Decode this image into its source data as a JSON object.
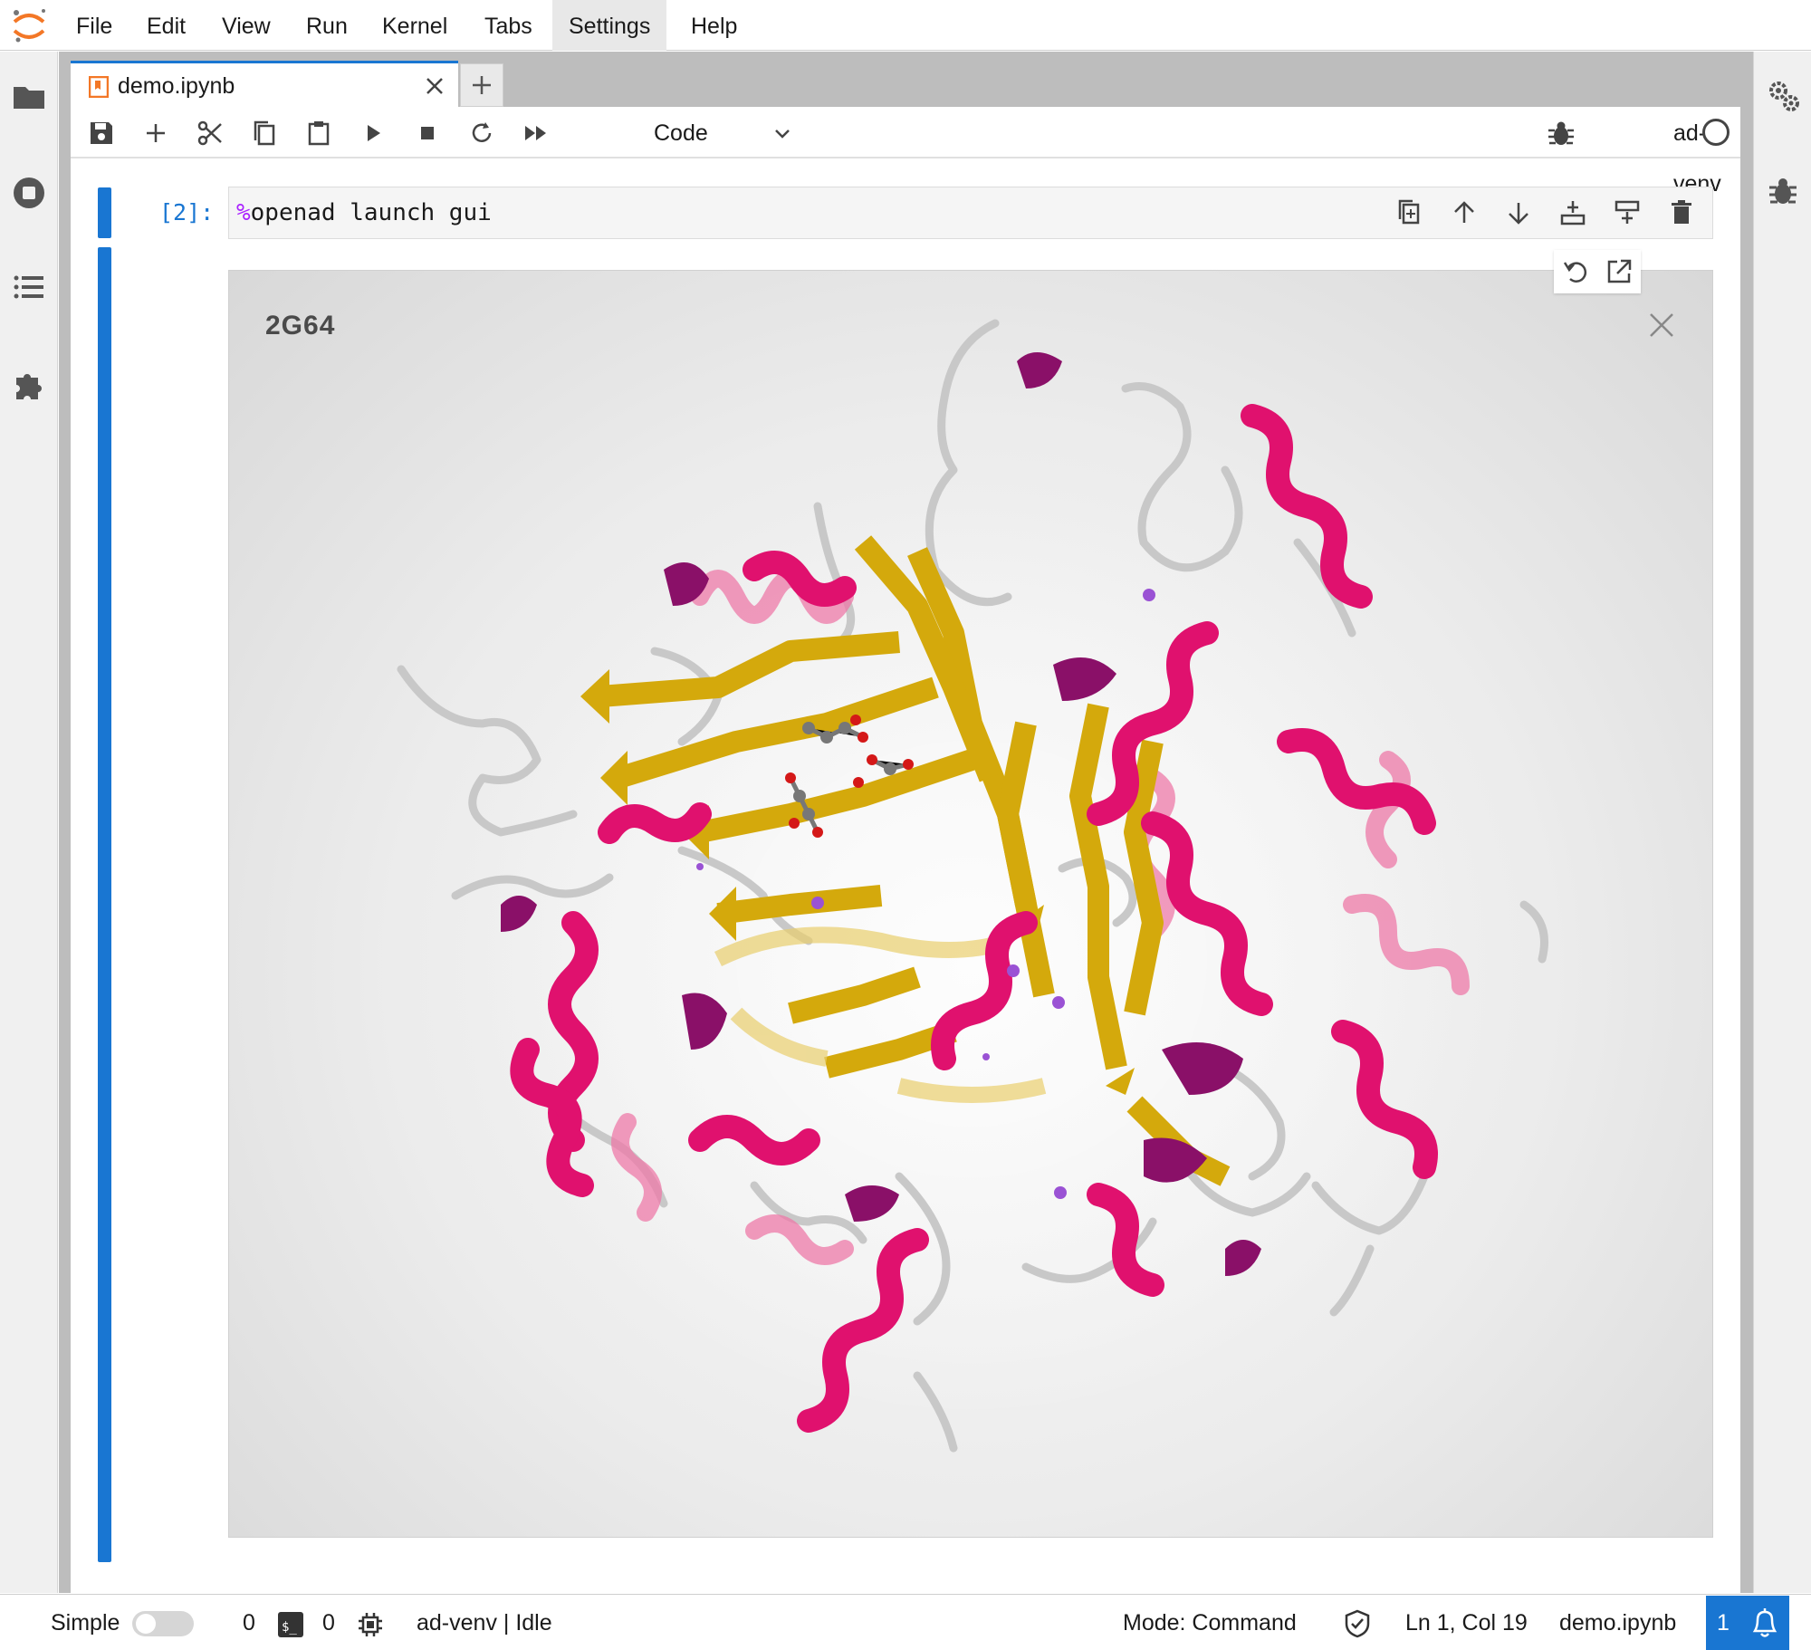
{
  "menu": {
    "items": [
      "File",
      "Edit",
      "View",
      "Run",
      "Kernel",
      "Tabs",
      "Settings",
      "Help"
    ],
    "active": "Settings"
  },
  "tab": {
    "label": "demo.ipynb"
  },
  "toolbar": {
    "cell_type": "Code",
    "kernel_name": "ad-venv"
  },
  "cell": {
    "prompt": "[2]:",
    "magic": "%",
    "code": "openad launch gui"
  },
  "viewer": {
    "title": "2G64"
  },
  "statusbar": {
    "mode_label": "Simple",
    "terminals": "0",
    "kernels": "0",
    "kernel_status": "ad-venv | Idle",
    "mode": "Mode: Command",
    "cursor": "Ln 1, Col 19",
    "file": "demo.ipynb",
    "notifications": "1"
  },
  "colors": {
    "accent": "#1976d2",
    "helix": "#e0116e",
    "sheet": "#d4a90c",
    "coil": "#c8c8c8"
  }
}
